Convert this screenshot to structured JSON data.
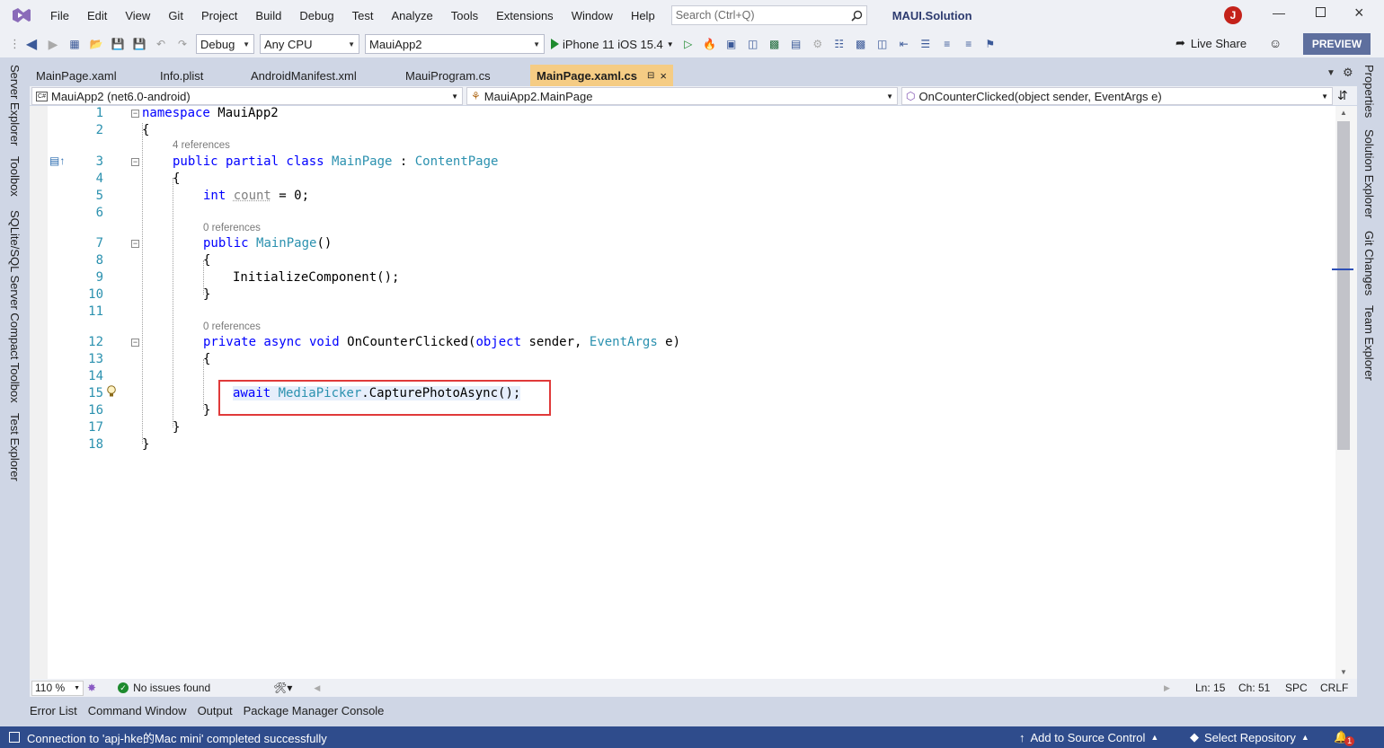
{
  "menu": [
    "File",
    "Edit",
    "View",
    "Git",
    "Project",
    "Build",
    "Debug",
    "Test",
    "Analyze",
    "Tools",
    "Extensions",
    "Window",
    "Help"
  ],
  "search": {
    "placeholder": "Search (Ctrl+Q)"
  },
  "solution_title": "MAUI.Solution",
  "user_initial": "J",
  "toolbar": {
    "config": "Debug",
    "platform": "Any CPU",
    "startup_project": "MauiApp2",
    "run_target": "iPhone 11 iOS 15.4",
    "live_share": "Live Share",
    "preview": "PREVIEW"
  },
  "left_panels": [
    "Server Explorer",
    "Toolbox",
    "SQLite/SQL Server Compact Toolbox",
    "Test Explorer"
  ],
  "right_panels": [
    "Properties",
    "Solution Explorer",
    "Git Changes",
    "Team Explorer"
  ],
  "tabs": [
    {
      "label": "MainPage.xaml",
      "active": false
    },
    {
      "label": "Info.plist",
      "active": false
    },
    {
      "label": "AndroidManifest.xml",
      "active": false
    },
    {
      "label": "MauiProgram.cs",
      "active": false
    },
    {
      "label": "MainPage.xaml.cs",
      "active": true
    }
  ],
  "navbar": {
    "project": "MauiApp2 (net6.0-android)",
    "type": "MauiApp2.MainPage",
    "member": "OnCounterClicked(object sender, EventArgs e)"
  },
  "code": {
    "line_numbers": [
      "1",
      "2",
      "3",
      "4",
      "5",
      "6",
      "7",
      "8",
      "9",
      "10",
      "11",
      "12",
      "13",
      "14",
      "15",
      "16",
      "17",
      "18"
    ],
    "refs": [
      "4 references",
      "0 references",
      "0 references"
    ],
    "l1_kw": "namespace",
    "l1_name": " MauiApp2",
    "brace_open": "{",
    "brace_close": "}",
    "l3_kw": "public partial class ",
    "l3_type": "MainPage",
    "l3_colon": " : ",
    "l3_base": "ContentPage",
    "l5_kw": "int ",
    "l5_var": "count",
    "l5_rest": " = 0;",
    "l7_kw": "public ",
    "l7_type": "MainPage",
    "l7_rest": "()",
    "l9": "InitializeComponent();",
    "l12_kw": "private async void ",
    "l12_name": "OnCounterClicked(",
    "l12_kw2": "object",
    "l12_p1": " sender, ",
    "l12_type": "EventArgs",
    "l12_p2": " e)",
    "l15_kw": "await ",
    "l15_type": "MediaPicker",
    "l15_rest": ".CapturePhotoAsync();"
  },
  "editor_status": {
    "zoom": "110 %",
    "issues": "No issues found",
    "ln": "Ln: 15",
    "ch": "Ch: 51",
    "spc": "SPC",
    "crlf": "CRLF"
  },
  "bottom_tabs": [
    "Error List",
    "Command Window",
    "Output",
    "Package Manager Console"
  ],
  "statusbar": {
    "message": "Connection to 'apj-hke的Mac mini' completed successfully",
    "source_control": "Add to Source Control",
    "repository": "Select Repository",
    "notifications": "1"
  },
  "colors": {
    "accent": "#2f4c8c",
    "active_tab": "#f5cc84",
    "highlight_box": "#e03a3a"
  }
}
